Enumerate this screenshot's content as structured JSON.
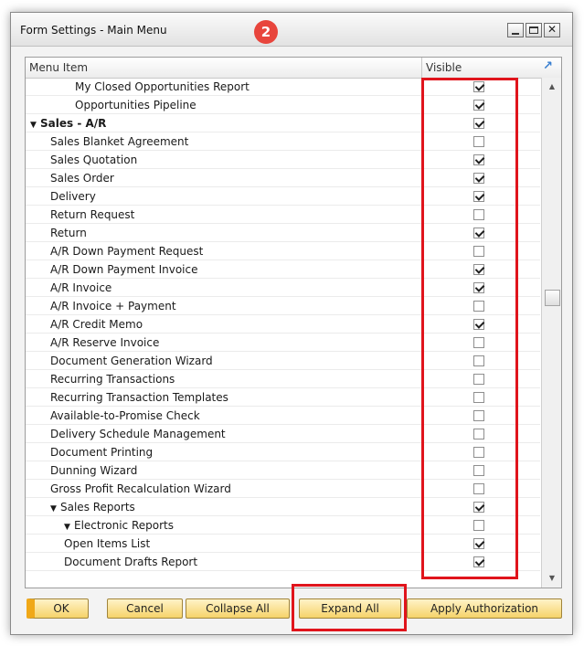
{
  "window": {
    "title": "Form Settings - Main Menu",
    "badge": "2",
    "close_glyph": "✕"
  },
  "table": {
    "col_item": "Menu Item",
    "col_visible": "Visible",
    "rows": [
      {
        "label": "My Closed Opportunities Report",
        "visible": true,
        "level": 3,
        "bold": false,
        "expander": ""
      },
      {
        "label": "Opportunities Pipeline",
        "visible": true,
        "level": 3,
        "bold": false,
        "expander": ""
      },
      {
        "label": "Sales - A/R",
        "visible": true,
        "level": 0,
        "bold": true,
        "expander": "▼"
      },
      {
        "label": "Sales Blanket Agreement",
        "visible": false,
        "level": 1,
        "bold": false,
        "expander": ""
      },
      {
        "label": "Sales Quotation",
        "visible": true,
        "level": 1,
        "bold": false,
        "expander": ""
      },
      {
        "label": "Sales Order",
        "visible": true,
        "level": 1,
        "bold": false,
        "expander": ""
      },
      {
        "label": "Delivery",
        "visible": true,
        "level": 1,
        "bold": false,
        "expander": ""
      },
      {
        "label": "Return Request",
        "visible": false,
        "level": 1,
        "bold": false,
        "expander": ""
      },
      {
        "label": "Return",
        "visible": true,
        "level": 1,
        "bold": false,
        "expander": ""
      },
      {
        "label": "A/R Down Payment Request",
        "visible": false,
        "level": 1,
        "bold": false,
        "expander": ""
      },
      {
        "label": "A/R Down Payment Invoice",
        "visible": true,
        "level": 1,
        "bold": false,
        "expander": ""
      },
      {
        "label": "A/R Invoice",
        "visible": true,
        "level": 1,
        "bold": false,
        "expander": ""
      },
      {
        "label": "A/R Invoice + Payment",
        "visible": false,
        "level": 1,
        "bold": false,
        "expander": ""
      },
      {
        "label": "A/R Credit Memo",
        "visible": true,
        "level": 1,
        "bold": false,
        "expander": ""
      },
      {
        "label": "A/R Reserve Invoice",
        "visible": false,
        "level": 1,
        "bold": false,
        "expander": ""
      },
      {
        "label": "Document Generation Wizard",
        "visible": false,
        "level": 1,
        "bold": false,
        "expander": ""
      },
      {
        "label": "Recurring Transactions",
        "visible": false,
        "level": 1,
        "bold": false,
        "expander": ""
      },
      {
        "label": "Recurring Transaction Templates",
        "visible": false,
        "level": 1,
        "bold": false,
        "expander": ""
      },
      {
        "label": "Available-to-Promise Check",
        "visible": false,
        "level": 1,
        "bold": false,
        "expander": ""
      },
      {
        "label": "Delivery Schedule Management",
        "visible": false,
        "level": 1,
        "bold": false,
        "expander": ""
      },
      {
        "label": "Document Printing",
        "visible": false,
        "level": 1,
        "bold": false,
        "expander": ""
      },
      {
        "label": "Dunning Wizard",
        "visible": false,
        "level": 1,
        "bold": false,
        "expander": ""
      },
      {
        "label": "Gross Profit Recalculation Wizard",
        "visible": false,
        "level": 1,
        "bold": false,
        "expander": ""
      },
      {
        "label": "Sales Reports",
        "visible": true,
        "level": 1,
        "bold": false,
        "expander": "▼"
      },
      {
        "label": "Electronic Reports",
        "visible": false,
        "level": 2,
        "bold": false,
        "expander": "▼"
      },
      {
        "label": "Open Items List",
        "visible": true,
        "level": 2,
        "bold": false,
        "expander": ""
      },
      {
        "label": "Document Drafts Report",
        "visible": true,
        "level": 2,
        "bold": false,
        "expander": ""
      }
    ]
  },
  "buttons": {
    "ok": "OK",
    "cancel": "Cancel",
    "collapse_all": "Collapse All",
    "expand_all": "Expand All",
    "apply_authorization": "Apply Authorization"
  },
  "highlight_color": "#e0141c",
  "accent_color": "#f0a818"
}
